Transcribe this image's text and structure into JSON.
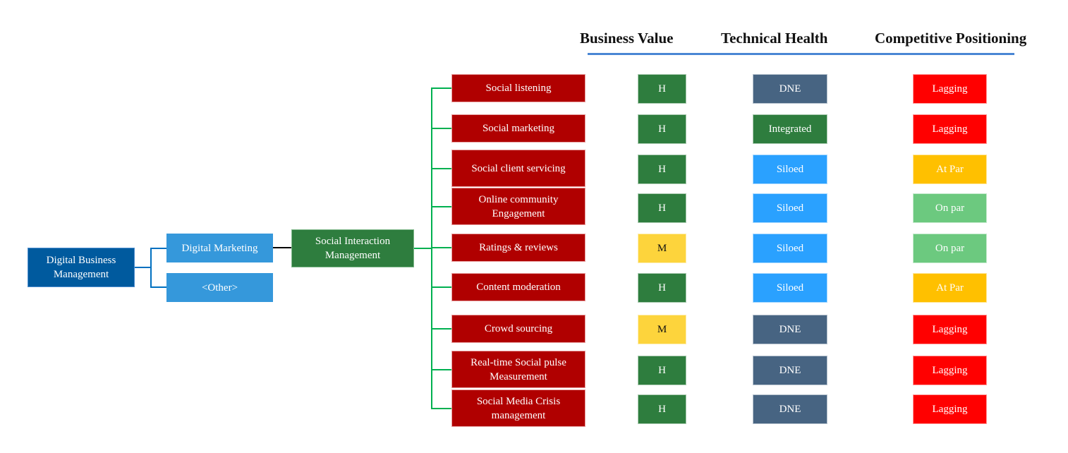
{
  "headers": {
    "business_value": "Business Value",
    "technical_health": "Technical Health",
    "competitive_positioning": "Competitive Positioning"
  },
  "colors": {
    "header_rule": "#4a86d4",
    "root": "#005a9e",
    "level1": "#3598db",
    "level2": "#2e7d3e",
    "capability": "#b00000",
    "connector_blue": "#0070c0",
    "connector_green": "#00b050",
    "bv_H": "#2e7d3e",
    "bv_M": "#fdd43c",
    "th_DNE": "#476482",
    "th_Integrated": "#2e7d3e",
    "th_Siloed": "#2aa1ff",
    "cp_Lagging": "#ff0000",
    "cp_AtPar": "#ffc000",
    "cp_OnPar": "#6cc97f"
  },
  "tree": {
    "root": "Digital Business Management",
    "level1": [
      "Digital Marketing",
      "<Other>"
    ],
    "level2": "Social Interaction Management"
  },
  "capabilities": [
    {
      "name": "Social listening",
      "business_value": "H",
      "technical_health": "DNE",
      "competitive_positioning": "Lagging"
    },
    {
      "name": "Social marketing",
      "business_value": "H",
      "technical_health": "Integrated",
      "competitive_positioning": "Lagging"
    },
    {
      "name": "Social client servicing",
      "business_value": "H",
      "technical_health": "Siloed",
      "competitive_positioning": "At Par"
    },
    {
      "name": "Online community Engagement",
      "business_value": "H",
      "technical_health": "Siloed",
      "competitive_positioning": "On par"
    },
    {
      "name": "Ratings & reviews",
      "business_value": "M",
      "technical_health": "Siloed",
      "competitive_positioning": "On par"
    },
    {
      "name": "Content moderation",
      "business_value": "H",
      "technical_health": "Siloed",
      "competitive_positioning": "At Par"
    },
    {
      "name": "Crowd sourcing",
      "business_value": "M",
      "technical_health": "DNE",
      "competitive_positioning": "Lagging"
    },
    {
      "name": "Real-time Social pulse Measurement",
      "business_value": "H",
      "technical_health": "DNE",
      "competitive_positioning": "Lagging"
    },
    {
      "name": "Social Media Crisis management",
      "business_value": "H",
      "technical_health": "DNE",
      "competitive_positioning": "Lagging"
    }
  ]
}
